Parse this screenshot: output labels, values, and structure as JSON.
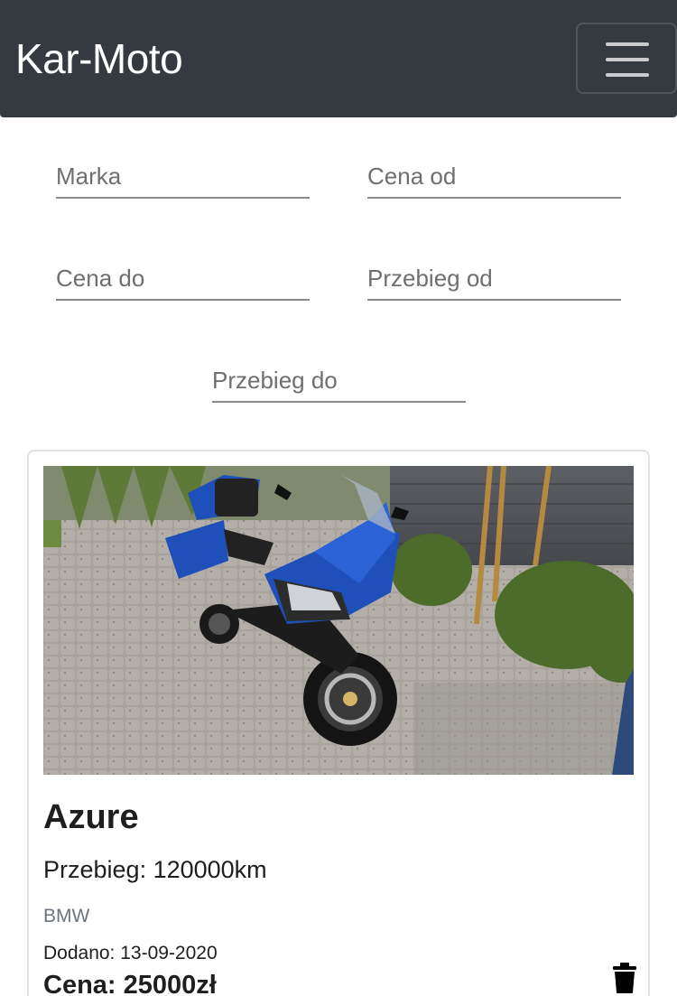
{
  "app": {
    "brand": "Kar-Moto"
  },
  "navbar": {
    "toggle_icon": "hamburger-menu-icon"
  },
  "filters": {
    "marka": {
      "placeholder": "Marka",
      "value": ""
    },
    "cena_od": {
      "placeholder": "Cena od",
      "value": ""
    },
    "cena_do": {
      "placeholder": "Cena do",
      "value": ""
    },
    "przebieg_od": {
      "placeholder": "Przebieg od",
      "value": ""
    },
    "przebieg_do": {
      "placeholder": "Przebieg do",
      "value": ""
    }
  },
  "listing": {
    "title": "Azure",
    "mileage": "Przebieg: 120000km",
    "make": "BMW",
    "added": "Dodano: 13-09-2020",
    "price": "Cena: 25000zł",
    "photo_icon": "motorcycle-photo",
    "delete_icon": "trash-icon"
  },
  "colors": {
    "navbar": "#343a40",
    "motorcycle_blue": "#1f4fb8"
  }
}
